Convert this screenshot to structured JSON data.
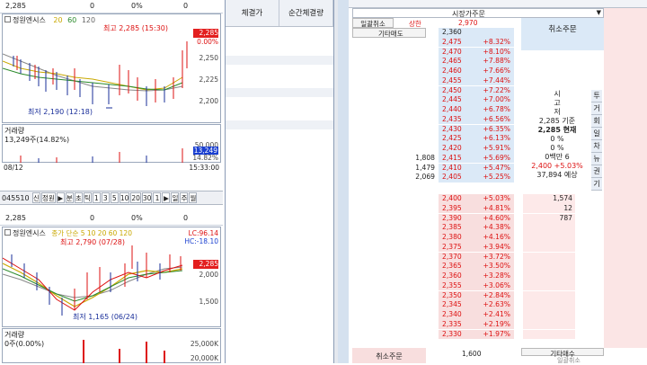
{
  "top_chart": {
    "price": "2,285",
    "zero1": "0",
    "zero2": "0",
    "pct": "0%",
    "stock": "정원엔시스",
    "ma": [
      "20",
      "60",
      "120"
    ],
    "high": "최고 2,285 (15:30)",
    "low": "최저 2,190 (12:18)",
    "price_tag": "2,285",
    "pct_tag": "0.00%",
    "yticks": [
      "2,250",
      "2,225",
      "2,200"
    ],
    "vol_label": "거래량",
    "vol_value": "13,249주(14.82%)",
    "vol_ticks": [
      "50,000",
      "13,249",
      "14.82%"
    ],
    "date": "08/12",
    "time": "15:33:00"
  },
  "toolbar": {
    "code": "045510",
    "buttons": [
      "신",
      "정원",
      "▶",
      "분",
      "초",
      "틱",
      "1",
      "3",
      "5",
      "10",
      "20",
      "30",
      "1",
      "▶",
      "일",
      "주",
      "월"
    ]
  },
  "bottom_chart": {
    "price": "2,285",
    "zero1": "0",
    "zero2": "0",
    "pct": "0%",
    "stock": "정원엔시스",
    "ma_text": "종가 단순 5  10  20  60  120",
    "lc": "LC:96.14",
    "hc": "HC:-18.10",
    "high": "최고 2,790 (07/28)",
    "low": "최저 1,165 (06/24)",
    "price_tag": "2,285",
    "yticks": [
      "2,000",
      "1,500"
    ],
    "vol_label": "거래량",
    "vol_value": "0주(0.00%)",
    "vol_ticks": [
      "25,000K",
      "20,000K"
    ]
  },
  "middle": {
    "col1": "체결가",
    "col2": "순간체결량"
  },
  "orderbook": {
    "title": "시장가주문",
    "cancel_all": "일괄취소",
    "upper": "상한",
    "upper_price": "2,970",
    "other_sell": "기타매도",
    "cancel_order": "취소주문",
    "side_text": [
      "시",
      "고",
      "저"
    ],
    "side_right": [
      "투",
      "거",
      "회",
      "일",
      "차",
      "뉴",
      "권",
      "기"
    ],
    "ref_label": "2,285 기준",
    "cur_label": "2,285 현재",
    "vol0": "0 %",
    "pct0": "0 %",
    "yesterday": "0백만 6",
    "expect": "2,400 +5.03%",
    "expect_vol": "37,894 예상",
    "bottom_cancel": "취소주문",
    "other_buy": "기타매수",
    "bottom_price": "1,600",
    "bottom_other": "일괄취소",
    "asks": [
      [
        "2,360",
        ""
      ],
      [
        "2,475",
        "+8.32%"
      ],
      [
        "2,470",
        "+8.10%"
      ],
      [
        "2,465",
        "+7.88%"
      ],
      [
        "2,460",
        "+7.66%"
      ],
      [
        "2,455",
        "+7.44%"
      ],
      [
        "2,450",
        "+7.22%"
      ],
      [
        "2,445",
        "+7.00%"
      ],
      [
        "2,440",
        "+6.78%"
      ],
      [
        "2,435",
        "+6.56%"
      ],
      [
        "2,430",
        "+6.35%"
      ],
      [
        "2,425",
        "+6.13%"
      ],
      [
        "2,420",
        "+5.91%"
      ],
      [
        "2,415",
        "+5.69%"
      ],
      [
        "2,410",
        "+5.47%"
      ],
      [
        "2,405",
        "+5.25%"
      ]
    ],
    "ask_qty": {
      "13": "1,808",
      "14": "1,479",
      "15": "2,069"
    },
    "bids": [
      [
        "2,400",
        "+5.03%"
      ],
      [
        "2,395",
        "+4.81%"
      ],
      [
        "2,390",
        "+4.60%"
      ],
      [
        "2,385",
        "+4.38%"
      ],
      [
        "2,380",
        "+4.16%"
      ],
      [
        "2,375",
        "+3.94%"
      ],
      [
        "2,370",
        "+3.72%"
      ],
      [
        "2,365",
        "+3.50%"
      ],
      [
        "2,360",
        "+3.28%"
      ],
      [
        "2,355",
        "+3.06%"
      ],
      [
        "2,350",
        "+2.84%"
      ],
      [
        "2,345",
        "+2.63%"
      ],
      [
        "2,340",
        "+2.41%"
      ],
      [
        "2,335",
        "+2.19%"
      ],
      [
        "2,330",
        "+1.97%"
      ]
    ],
    "bid_qty": {
      "0": "1,574",
      "1": "12",
      "2": "787"
    }
  }
}
